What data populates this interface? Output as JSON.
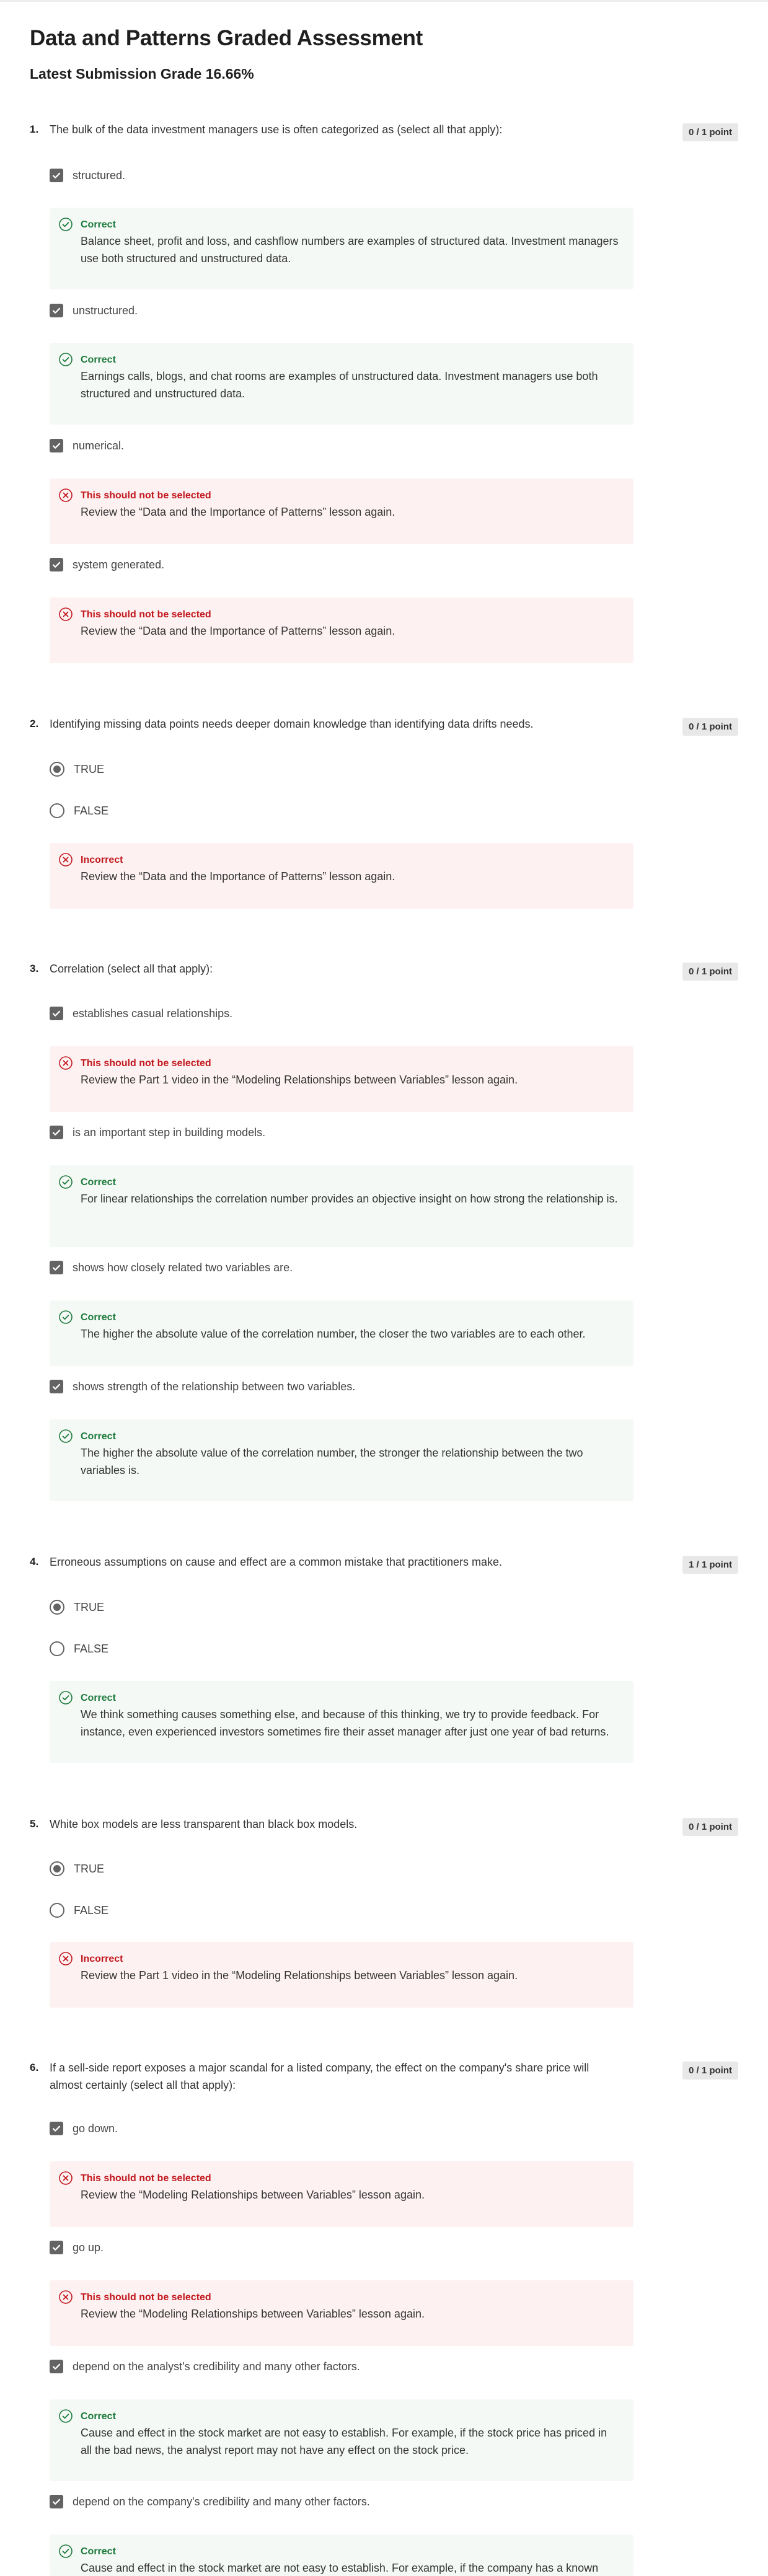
{
  "header": {
    "title": "Data and Patterns Graded Assessment",
    "grade": "Latest Submission Grade 16.66%"
  },
  "questions": [
    {
      "num": "1.",
      "text": "The bulk of the data investment managers use is often categorized as (select all that apply):",
      "points": "0 / 1 point",
      "options": [
        {
          "label": "structured.",
          "fb_title": "Correct",
          "fb_text": "Balance sheet, profit and loss, and cashflow numbers are examples of structured data. Investment managers use both structured and unstructured data."
        },
        {
          "label": "unstructured.",
          "fb_title": "Correct",
          "fb_text": "Earnings calls, blogs, and chat rooms are examples of unstructured data. Investment managers use both structured and unstructured data."
        },
        {
          "label": "numerical.",
          "fb_title": "This should not be selected",
          "fb_text": "Review the “Data and the Importance of Patterns” lesson again."
        },
        {
          "label": "system generated.",
          "fb_title": "This should not be selected",
          "fb_text": "Review the “Data and the Importance of Patterns” lesson again."
        }
      ]
    },
    {
      "num": "2.",
      "text": "Identifying missing data points needs deeper domain knowledge than identifying data drifts needs.",
      "points": "0 / 1 point",
      "options": [
        {
          "label": "TRUE"
        },
        {
          "label": "FALSE"
        }
      ],
      "fb_title": "Incorrect",
      "fb_text": "Review the “Data and the Importance of Patterns” lesson again."
    },
    {
      "num": "3.",
      "text": "Correlation (select all that apply):",
      "points": "0 / 1 point",
      "options": [
        {
          "label": "establishes casual relationships.",
          "fb_title": "This should not be selected",
          "fb_text": "Review the Part 1 video in the “Modeling Relationships between Variables” lesson again."
        },
        {
          "label": "is an important step in building models.",
          "fb_title": "Correct",
          "fb_text": "For linear relationships the correlation number provides an objective insight on how strong the relationship is."
        },
        {
          "label": "shows how closely related two variables are.",
          "fb_title": "Correct",
          "fb_text": "The higher the absolute value of the correlation number, the closer the two variables are to each other."
        },
        {
          "label": "shows strength of the relationship between two variables.",
          "fb_title": "Correct",
          "fb_text": "The higher the absolute value of the correlation number, the stronger the relationship between the two variables is."
        }
      ]
    },
    {
      "num": "4.",
      "text": "Erroneous assumptions on cause and effect are a common mistake that practitioners make.",
      "points": "1 / 1 point",
      "options": [
        {
          "label": "TRUE"
        },
        {
          "label": "FALSE"
        }
      ],
      "fb_title": "Correct",
      "fb_text": "We think something causes something else, and because of this thinking, we try to provide feedback. For instance, even experienced investors sometimes fire their asset manager after just one year of bad returns."
    },
    {
      "num": "5.",
      "text": "White box models are less transparent than black box models.",
      "points": "0 / 1 point",
      "options": [
        {
          "label": "TRUE"
        },
        {
          "label": "FALSE"
        }
      ],
      "fb_title": "Incorrect",
      "fb_text": "Review the Part 1 video in the “Modeling Relationships between Variables” lesson again."
    },
    {
      "num": "6.",
      "text": "If a sell-side report exposes a major scandal for a listed company, the effect on the company's share price will almost certainly (select all that apply):",
      "points": "0 / 1 point",
      "options": [
        {
          "label": "go down.",
          "fb_title": "This should not be selected",
          "fb_text": "Review the “Modeling Relationships between Variables” lesson again."
        },
        {
          "label": "go up.",
          "fb_title": "This should not be selected",
          "fb_text": "Review the “Modeling Relationships between Variables” lesson again."
        },
        {
          "label": "depend on the analyst's credibility and many other factors.",
          "fb_title": "Correct",
          "fb_text": "Cause and effect in the stock market are not easy to establish. For example, if the stock price has priced in all the bad news, the analyst report may not have any effect on the stock price."
        },
        {
          "label": "depend on the company's credibility and many other factors.",
          "fb_title": "Correct",
          "fb_text": "Cause and effect in the stock market are not easy to establish. For example, if the company has a known"
        }
      ]
    }
  ],
  "colors": {
    "correct": "#1d7a3c",
    "incorrect": "#c2181e",
    "correct_bg": "#f5f9f5",
    "incorrect_bg": "#fdf1f2",
    "control": "#636363"
  },
  "icons": {
    "checkbox": "checkbox-checked-icon",
    "radio": "radio-icon",
    "correct": "check-circle-icon",
    "incorrect": "x-circle-icon"
  }
}
